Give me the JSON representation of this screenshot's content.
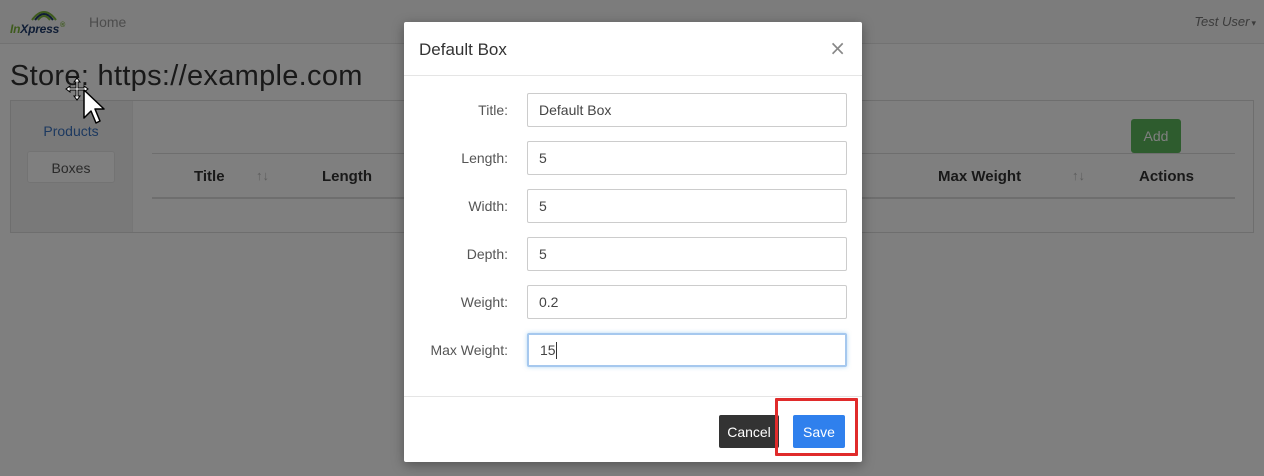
{
  "navbar": {
    "brand": "InXpress",
    "home": "Home",
    "user": "Test User",
    "user_caret": "▾"
  },
  "page": {
    "title": "Store: https://example.com"
  },
  "sidebar": {
    "items": [
      {
        "label": "Products"
      },
      {
        "label": "Boxes"
      }
    ]
  },
  "table": {
    "add_label": "Add",
    "columns": [
      {
        "label": "Title"
      },
      {
        "label": "Length"
      },
      {
        "label": "Max Weight"
      },
      {
        "label": "Actions"
      }
    ],
    "sort_glyph": "↑↓"
  },
  "modal": {
    "title": "Default Box",
    "close": "×",
    "fields": [
      {
        "label": "Title:",
        "value": "Default Box"
      },
      {
        "label": "Length:",
        "value": "5"
      },
      {
        "label": "Width:",
        "value": "5"
      },
      {
        "label": "Depth:",
        "value": "5"
      },
      {
        "label": "Weight:",
        "value": "0.2"
      },
      {
        "label": "Max Weight:",
        "value": "15"
      }
    ],
    "cancel": "Cancel",
    "save": "Save"
  },
  "colors": {
    "save": "#2f80ed",
    "cancel": "#333333",
    "add": "#5cb85c",
    "highlight": "#e02b2b"
  },
  "icons": {
    "cursor": "move-cursor-icon",
    "logo": "inxpress-logo"
  }
}
